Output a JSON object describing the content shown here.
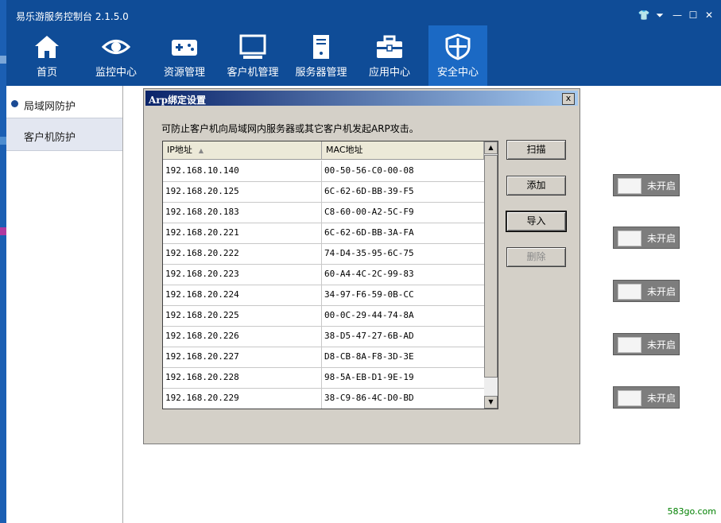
{
  "app": {
    "title": "易乐游服务控制台 2.1.5.0"
  },
  "window_controls": {
    "skin": "👕",
    "menu": "⏷",
    "minimize": "—",
    "maximize": "☐",
    "close": "✕"
  },
  "nav": [
    {
      "label": "首页",
      "icon": "home-icon"
    },
    {
      "label": "监控中心",
      "icon": "eye-icon"
    },
    {
      "label": "资源管理",
      "icon": "gamepad-icon"
    },
    {
      "label": "客户机管理",
      "icon": "monitor-icon"
    },
    {
      "label": "服务器管理",
      "icon": "server-icon"
    },
    {
      "label": "应用中心",
      "icon": "toolbox-icon"
    },
    {
      "label": "安全中心",
      "icon": "shield-icon",
      "active": true
    }
  ],
  "sidebar": [
    {
      "label": "局域网防护",
      "selected": true
    },
    {
      "label": "客户机防护",
      "selected": false
    }
  ],
  "toggles": [
    "未开启",
    "未开启",
    "未开启",
    "未开启",
    "未开启"
  ],
  "dialog": {
    "title": "Arp绑定设置",
    "close": "x",
    "description": "可防止客户机向局域网内服务器或其它客户机发起ARP攻击。",
    "columns": {
      "ip": "IP地址",
      "mac": "MAC地址"
    },
    "rows": [
      {
        "ip": "192.168.10.140",
        "mac": "00-50-56-C0-00-08"
      },
      {
        "ip": "192.168.20.125",
        "mac": "6C-62-6D-BB-39-F5"
      },
      {
        "ip": "192.168.20.183",
        "mac": "C8-60-00-A2-5C-F9"
      },
      {
        "ip": "192.168.20.221",
        "mac": "6C-62-6D-BB-3A-FA"
      },
      {
        "ip": "192.168.20.222",
        "mac": "74-D4-35-95-6C-75"
      },
      {
        "ip": "192.168.20.223",
        "mac": "60-A4-4C-2C-99-83"
      },
      {
        "ip": "192.168.20.224",
        "mac": "34-97-F6-59-0B-CC"
      },
      {
        "ip": "192.168.20.225",
        "mac": "00-0C-29-44-74-8A"
      },
      {
        "ip": "192.168.20.226",
        "mac": "38-D5-47-27-6B-AD"
      },
      {
        "ip": "192.168.20.227",
        "mac": "D8-CB-8A-F8-3D-3E"
      },
      {
        "ip": "192.168.20.228",
        "mac": "98-5A-EB-D1-9E-19"
      },
      {
        "ip": "192.168.20.229",
        "mac": "38-C9-86-4C-D0-BD"
      }
    ],
    "buttons": {
      "scan": "扫描",
      "add": "添加",
      "import": "导入",
      "delete": "删除"
    }
  },
  "watermark": "583go.com"
}
